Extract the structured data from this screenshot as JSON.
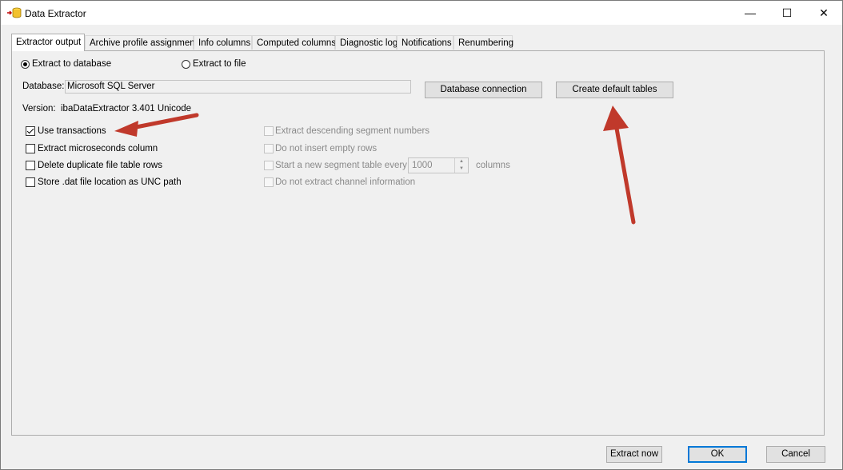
{
  "window": {
    "title": "Data Extractor",
    "minimize": "—",
    "maximize": "☐",
    "close": "✕"
  },
  "tabs": [
    {
      "label": "Extractor output",
      "active": true
    },
    {
      "label": "Archive profile assignment"
    },
    {
      "label": "Info columns"
    },
    {
      "label": "Computed columns"
    },
    {
      "label": "Diagnostic log"
    },
    {
      "label": "Notifications"
    },
    {
      "label": "Renumbering"
    }
  ],
  "output": {
    "extract_to_database": "Extract to database",
    "extract_to_file": "Extract to file",
    "database_label": "Database:",
    "database_value": "Microsoft SQL Server",
    "db_connection_button": "Database connection",
    "create_tables_button": "Create default tables",
    "version_label": "Version:",
    "version_value": "ibaDataExtractor 3.401 Unicode"
  },
  "options_left": [
    {
      "label": "Use transactions",
      "checked": true
    },
    {
      "label": "Extract microseconds column",
      "checked": false
    },
    {
      "label": "Delete duplicate file table rows",
      "checked": false
    },
    {
      "label": "Store .dat file location as UNC path",
      "checked": false
    }
  ],
  "options_right": [
    {
      "label": "Extract descending segment numbers",
      "enabled": false
    },
    {
      "label": "Do not insert empty rows",
      "enabled": false
    },
    {
      "label": "Start a new segment table every",
      "enabled": false
    },
    {
      "label": "Do not extract channel information",
      "enabled": false
    }
  ],
  "segment": {
    "value": "1000",
    "unit": "columns"
  },
  "footer": {
    "extract_now": "Extract now",
    "ok": "OK",
    "cancel": "Cancel"
  },
  "colors": {
    "accent": "#0078d7",
    "annotation_arrow": "#c0392b"
  }
}
